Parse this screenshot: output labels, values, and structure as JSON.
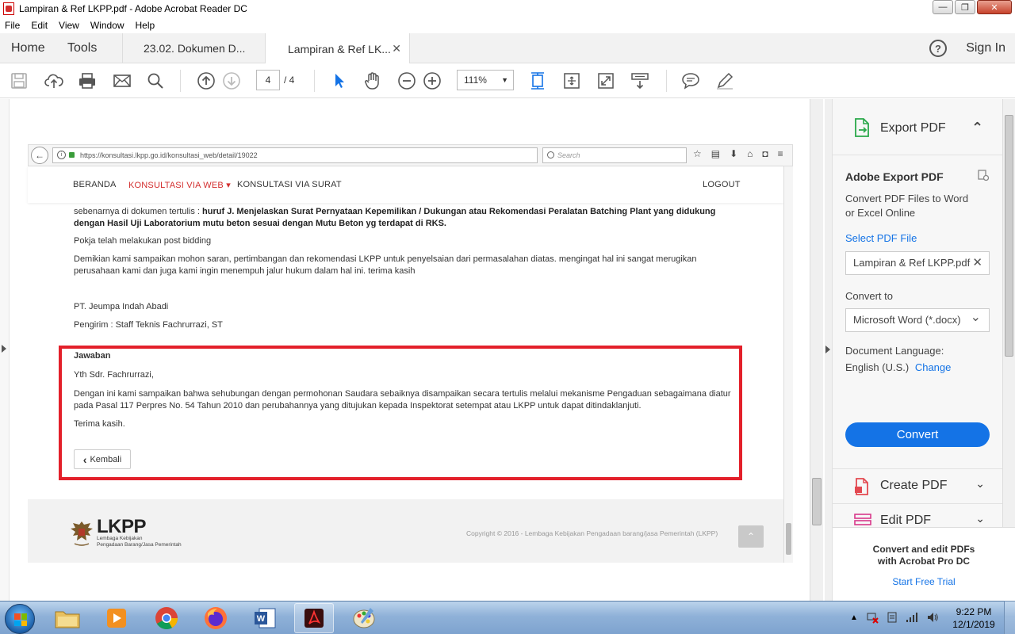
{
  "window": {
    "title": "Lampiran & Ref LKPP.pdf - Adobe Acrobat Reader DC",
    "minimize": "—",
    "restore": "❐",
    "close": "✕"
  },
  "menu": [
    "File",
    "Edit",
    "View",
    "Window",
    "Help"
  ],
  "tabbar": {
    "home": "Home",
    "tools": "Tools",
    "tabs": [
      {
        "label": "23.02. Dokumen D..."
      },
      {
        "label": "Lampiran & Ref LK...",
        "close": "✕"
      }
    ],
    "help": "?",
    "signin": "Sign In"
  },
  "toolbar": {
    "page_current": "4",
    "page_total": "/  4",
    "zoom": "111%",
    "zoom_caret": "▼"
  },
  "browser": {
    "back": "←",
    "info": "i",
    "url": "https://konsultasi.lkpp.go.id/konsultasi_web/detail/19022",
    "search_placeholder": "Search",
    "icons": [
      "☆",
      "▤",
      "⬇",
      "⌂",
      "◘",
      "≡"
    ]
  },
  "site": {
    "nav": [
      "BERANDA",
      "KONSULTASI VIA WEB ▾",
      "KONSULTASI VIA SURAT",
      "LOGOUT"
    ],
    "para1_pre": "sebenarnya di dokumen tertulis : ",
    "para1_bold": "huruf J. Menjelaskan Surat Pernyataan Kepemilikan / Dukungan atau Rekomendasi Peralatan Batching Plant yang didukung dengan Hasil Uji Laboratorium mutu beton sesuai dengan Mutu Beton yg terdapat di RKS.",
    "para2": "Pokja telah melakukan post bidding",
    "para3": "Demikian kami sampaikan mohon saran, pertimbangan dan rekomendasi LKPP untuk penyelsaian dari permasalahan diatas. mengingat hal ini sangat merugikan perusahaan kami dan juga kami ingin menempuh jalur hukum dalam hal ini. terima kasih",
    "company": "PT. Jeumpa Indah Abadi",
    "sender": "Pengirim : Staff Teknis Fachrurrazi, ST",
    "answer_title": "Jawaban",
    "answer_greeting": "Yth Sdr. Fachrurrazi,",
    "answer_body": "Dengan ini kami sampaikan bahwa sehubungan dengan permohonan Saudara sebaiknya disampaikan secara tertulis melalui mekanisme Pengaduan sebagaimana diatur pada Pasal 117 Perpres No. 54 Tahun 2010 dan perubahannya yang ditujukan kepada Inspektorat setempat atau LKPP untuk dapat ditindaklanjuti.",
    "answer_thanks": "Terima kasih.",
    "back_button": "Kembali",
    "back_chevron": "‹",
    "logo_text": "LKPP",
    "logo_sub1": "Lembaga Kebijakan",
    "logo_sub2": "Pengadaan Barang/Jasa Pemerintah",
    "copyright": "Copyright © 2016 - Lembaga Kebijakan Pengadaan barang/jasa Pemerintah (LKPP)",
    "to_top": "⌃"
  },
  "right_pane": {
    "export_title": "Export PDF",
    "export_chevron": "⌃",
    "adobe_export": "Adobe Export PDF",
    "desc_line1": "Convert PDF Files to Word",
    "desc_line2": "or Excel Online",
    "select_pdf_label": "Select PDF File",
    "selected_file": "Lampiran & Ref LKPP.pdf",
    "clear": "✕",
    "convert_to_label": "Convert to",
    "convert_to_value": "Microsoft Word (*.docx)",
    "dropdown_chevron": "⌄",
    "doc_language_label": "Document Language:",
    "doc_language_value": "English (U.S.)",
    "change_link": "Change",
    "convert_button": "Convert",
    "create_pdf": "Create PDF",
    "edit_pdf": "Edit PDF",
    "item_chevron": "⌄",
    "promo_line1": "Convert and edit PDFs",
    "promo_line2": "with Acrobat Pro DC",
    "free_trial": "Start Free Trial"
  },
  "taskbar": {
    "time": "9:22 PM",
    "date": "12/1/2019"
  },
  "colors": {
    "accent": "#1473e6",
    "highlight_box": "#e3202a",
    "nav_active": "#d32f2f"
  }
}
